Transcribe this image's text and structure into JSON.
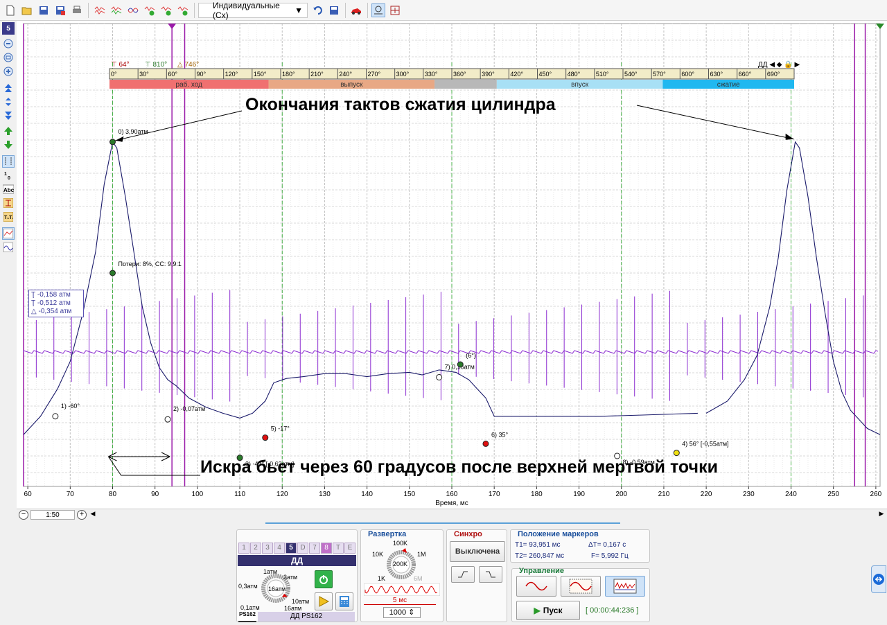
{
  "toolbar": {
    "view_mode": "Индивидуальные (Сх)",
    "icons": [
      "new-file-icon",
      "open-folder-icon",
      "save-icon",
      "save-as-icon",
      "print-icon",
      "waveform-icon",
      "waveform-multi-icon",
      "waveform-compare-icon",
      "waveform-ok-icon",
      "waveform-1-icon",
      "waveform-2-icon",
      "undo-icon",
      "save-disk-icon",
      "car-icon",
      "zoom-fit-icon",
      "split-icon"
    ]
  },
  "left_panel": {
    "channel_badge": "5"
  },
  "degree_scale": {
    "marker1": "64°",
    "marker2": "810°",
    "delta": "746°",
    "dd_label": "ДД",
    "ticks": [
      "0°",
      "30°",
      "60°",
      "90°",
      "120°",
      "150°",
      "180°",
      "210°",
      "240°",
      "270°",
      "300°",
      "330°",
      "360°",
      "390°",
      "420°",
      "450°",
      "480°",
      "510°",
      "540°",
      "570°",
      "600°",
      "630°",
      "660°",
      "690°"
    ],
    "strokes": [
      {
        "label": "раб. ход",
        "color": "#f07070"
      },
      {
        "label": "выпуск",
        "color": "#e8a885"
      },
      {
        "label": "",
        "color": "#b8b8b8"
      },
      {
        "label": "впуск",
        "color": "#a8e0f5"
      },
      {
        "label": "сжатие",
        "color": "#20b8f0"
      }
    ]
  },
  "marker_values": {
    "m1": "-0,158 атм",
    "m2": "-0,512 атм",
    "delta": "-0,354 атм"
  },
  "annotations": {
    "top": "Окончания тактов сжатия цилиндра",
    "bottom": "Искра бьет через 60 градусов после верхней мертвой точки"
  },
  "points": [
    {
      "label": "0)  3,90атм"
    },
    {
      "label": "Потери: 8%, СС: 9,9:1"
    },
    {
      "label": "1)  -60°"
    },
    {
      "label": "2)  -0,07атм"
    },
    {
      "label": "3)  -43° [-0,63атм]"
    },
    {
      "label": "5)  -17°"
    },
    {
      "label": "7)  0,16атм"
    },
    {
      "label": "(6°)"
    },
    {
      "label": "6)  35°"
    },
    {
      "label": "8)  -0,59атм"
    },
    {
      "label": "4)  56° [-0,55атм]"
    }
  ],
  "chart_data": {
    "type": "line",
    "xlabel": "Время, мс",
    "xlim": [
      59,
      261
    ],
    "x_ticks": [
      60,
      70,
      80,
      90,
      100,
      110,
      120,
      130,
      140,
      150,
      160,
      170,
      180,
      190,
      200,
      210,
      220,
      230,
      240,
      250,
      260
    ],
    "series": [
      {
        "points": [
          [
            59,
            -0.9
          ],
          [
            63,
            -0.6
          ],
          [
            67,
            -0.15
          ],
          [
            70,
            0.3
          ],
          [
            73,
            1.1
          ],
          [
            76,
            2.1
          ],
          [
            78,
            3.2
          ],
          [
            80,
            3.9
          ],
          [
            81,
            3.8
          ],
          [
            83,
            3.0
          ],
          [
            85,
            2.1
          ],
          [
            87,
            1.2
          ],
          [
            89,
            0.6
          ],
          [
            91,
            0.2
          ],
          [
            93,
            0.0
          ],
          [
            95,
            -0.1
          ],
          [
            98,
            -0.3
          ],
          [
            102,
            -0.45
          ],
          [
            106,
            -0.55
          ],
          [
            110,
            -0.63
          ],
          [
            113,
            -0.55
          ],
          [
            116,
            -0.35
          ],
          [
            118,
            -0.05
          ],
          [
            121,
            0.02
          ],
          [
            125,
            0.05
          ],
          [
            130,
            0.1
          ],
          [
            135,
            0.1
          ],
          [
            140,
            0.05
          ],
          [
            145,
            0.1
          ],
          [
            150,
            0.12
          ],
          [
            153,
            0.08
          ],
          [
            157,
            0.16
          ],
          [
            161,
            0.12
          ],
          [
            164,
            0.0
          ],
          [
            166,
            -0.15
          ],
          [
            168,
            -0.3
          ],
          [
            170,
            -0.6
          ],
          [
            175,
            -0.6
          ],
          [
            185,
            -0.6
          ],
          [
            195,
            -0.6
          ],
          [
            205,
            -0.58
          ],
          [
            218,
            -0.55
          ]
        ]
      },
      {
        "points": [
          [
            220,
            -0.55
          ],
          [
            225,
            -0.35
          ],
          [
            229,
            0.0
          ],
          [
            232,
            0.4
          ],
          [
            235,
            1.2
          ],
          [
            237,
            2.0
          ],
          [
            239,
            3.1
          ],
          [
            241,
            3.9
          ],
          [
            242,
            3.8
          ],
          [
            244,
            3.0
          ],
          [
            246,
            2.0
          ],
          [
            248,
            1.1
          ],
          [
            250,
            0.3
          ],
          [
            252,
            -0.2
          ],
          [
            254,
            -0.5
          ],
          [
            258,
            -0.8
          ],
          [
            261,
            -0.9
          ]
        ]
      }
    ]
  },
  "bottom": {
    "scale_value": "1:50",
    "channel_tabs": [
      "1",
      "2",
      "3",
      "4",
      "5",
      "D",
      "7",
      "8",
      "T",
      "E"
    ],
    "channel_name": "ДД",
    "range_labels": [
      "1атм",
      "3атм",
      "0,3атм",
      "16атм",
      "0,1атм",
      "10атм",
      "16атм"
    ],
    "sensor_name": "ДД PS162",
    "sensor_badge": "PS162",
    "sweep_title": "Развертка",
    "sweep_labels": [
      "100K",
      "10K",
      "1M",
      "200K",
      "1K",
      "6M"
    ],
    "sweep_time": "5 мс",
    "sweep_points": "1000",
    "sync_title": "Синхро",
    "sync_state": "Выключена",
    "markers_title": "Положение маркеров",
    "t1": "T1= 93,951 мс",
    "t2": "T2= 260,847 мс",
    "dt": "ΔT= 0,167 с",
    "freq": "F= 5,992 Гц",
    "control_title": "Управление",
    "start": "Пуск",
    "elapsed": "[ 00:00:44:236 ]"
  }
}
